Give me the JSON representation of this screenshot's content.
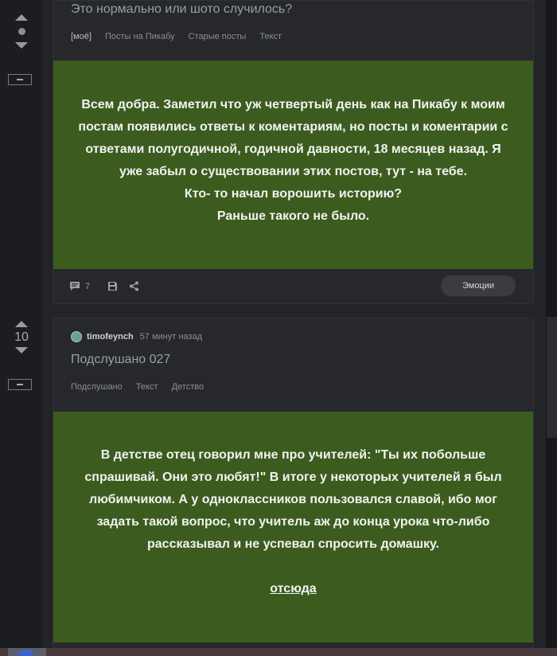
{
  "post1": {
    "title": "Это нормально или шото случилось?",
    "tags": [
      "[моё]",
      "Посты на Пикабу",
      "Старые посты",
      "Текст"
    ],
    "body_lines": [
      "Всем добра. Заметил что уж четвертый день как на Пикабу к моим",
      "постам появились ответы к коментариям, но посты и коментарии с",
      "ответами полугодичной, годичной давности, 18 месяцев назад. Я",
      "уже забыл о существовании этих постов, тут - на тебе.",
      "Кто- то начал ворошить историю?",
      "Раньше такого не было."
    ],
    "comments_count": "7",
    "emotions_label": "Эмоции"
  },
  "post2": {
    "score": "10",
    "author": "timofeynch",
    "time": "57 минут назад",
    "title": "Подслушано 027",
    "tags": [
      "Подслушано",
      "Текст",
      "Детство"
    ],
    "body_lines": [
      "В детстве отец говорил мне про учителей: \"Ты их побольше",
      "спрашивай. Они это любят!\" В итоге у некоторых учителей я был",
      "любимчиком. А у одноклассников пользовался славой, ибо мог",
      "задать такой вопрос, что учитель аж до конца урока что-либо",
      "рассказывал и не успевал спросить домашку."
    ],
    "link_text": "отсюда"
  },
  "colors": {
    "accent_green": "#3b5c1e",
    "background": "#1b1d20",
    "card": "#26282c"
  }
}
